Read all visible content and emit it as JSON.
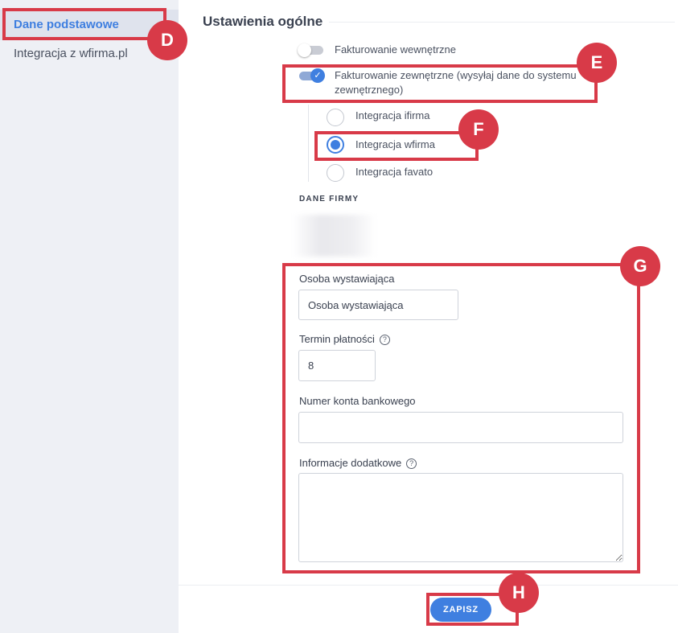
{
  "sidebar": {
    "items": [
      {
        "label": "Dane podstawowe"
      },
      {
        "label": "Integracja z wfirma.pl"
      }
    ]
  },
  "main": {
    "title": "Ustawienia ogólne",
    "toggles": [
      {
        "label": "Fakturowanie wewnętrzne",
        "on": false
      },
      {
        "label_line1": "Fakturowanie zewnętrzne (wysyłaj dane do systemu",
        "label_line2": "zewnętrznego)",
        "on": true
      }
    ],
    "integrations": [
      {
        "label": "Integracja ifirma",
        "checked": false
      },
      {
        "label": "Integracja wfirma",
        "checked": true
      },
      {
        "label": "Integracja favato",
        "checked": false
      }
    ],
    "section_heading": "DANE FIRMY",
    "fields": {
      "issuer_label": "Osoba wystawiająca",
      "issuer_value": "Osoba wystawiająca",
      "payment_term_label": "Termin płatności",
      "payment_term_value": "8",
      "bank_account_label": "Numer konta bankowego",
      "bank_account_value": "",
      "additional_info_label": "Informacje dodatkowe",
      "additional_info_value": ""
    },
    "help_glyph": "?",
    "save_label": "ZAPISZ"
  },
  "annotations": {
    "badges": [
      "D",
      "E",
      "F",
      "G",
      "H"
    ],
    "color": "#d83a48"
  },
  "colors": {
    "accent": "#3f7fe0",
    "sidebar_bg": "#eef0f5"
  }
}
